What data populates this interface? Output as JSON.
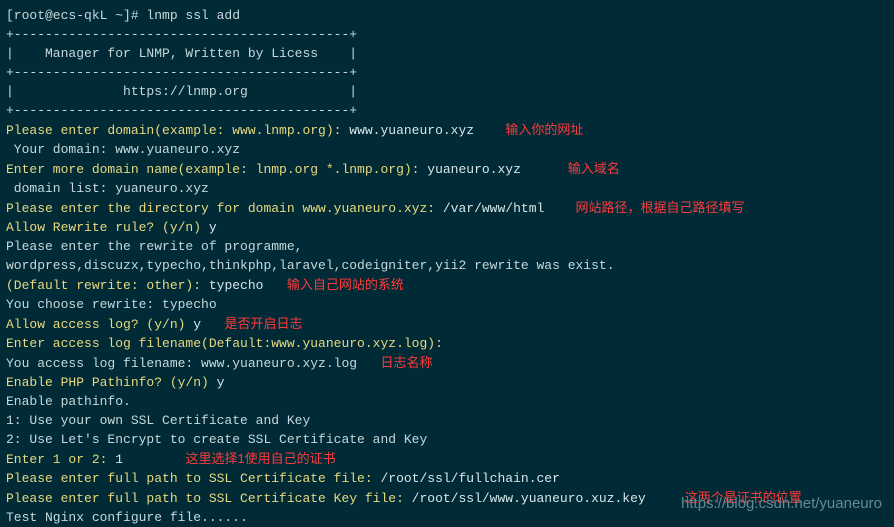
{
  "prompt_line": "[root@ecs-qkL ~]# lnmp ssl add",
  "sep": "+-------------------------------------------+",
  "banner1": "|    Manager for LNMP, Written by Licess    |",
  "banner2": "|              https://lnmp.org             |",
  "s1": {
    "prompt": "Please enter domain(example: www.lnmp.org): ",
    "val": "www.yuaneuro.xyz",
    "note": "输入你的网址"
  },
  "s1b": " Your domain: www.yuaneuro.xyz",
  "s2": {
    "prompt": "Enter more domain name(example: lnmp.org *.lnmp.org): ",
    "val": "yuaneuro.xyz",
    "note": "输入域名"
  },
  "s2b": " domain list: yuaneuro.xyz",
  "s3": {
    "prompt": "Please enter the directory for domain www.yuaneuro.xyz: ",
    "val": "/var/www/html",
    "note": "网站路径，根据自己路径填写"
  },
  "s4": {
    "prompt": "Allow Rewrite rule? (y/n) ",
    "val": "y"
  },
  "s5a": "Please enter the rewrite of programme, ",
  "s5b": "wordpress,discuzx,typecho,thinkphp,laravel,codeigniter,yii2 rewrite was exist.",
  "s6": {
    "prompt": "(Default rewrite: other): ",
    "val": "typecho",
    "note": "输入自己网站的系统"
  },
  "s6b": "You choose rewrite: typecho",
  "s7": {
    "prompt": "Allow access log? (y/n) ",
    "val": "y",
    "note": "是否开启日志"
  },
  "s8": {
    "prompt": "Enter access log filename(Default:www.yuaneuro.xyz.log): "
  },
  "s8b": {
    "t": "You access log filename: www.yuaneuro.xyz.log",
    "note": "日志名称"
  },
  "s9": {
    "prompt": "Enable PHP Pathinfo? (y/n) ",
    "val": "y"
  },
  "s9b": "Enable pathinfo.",
  "s10a": "1: Use your own SSL Certificate and Key",
  "s10b": "2: Use Let's Encrypt to create SSL Certificate and Key",
  "s11": {
    "prompt": "Enter 1 or 2: ",
    "val": "1",
    "note": "这里选择1使用自己的证书"
  },
  "s12": {
    "prompt": "Please enter full path to SSL Certificate file: ",
    "val": "/root/ssl/fullchain.cer"
  },
  "s13": {
    "prompt": "Please enter full path to SSL Certificate Key file: ",
    "val": "/root/ssl/www.yuaneuro.xuz.key",
    "note": "这两个是证书的位置"
  },
  "s14": "Test Nginx configure file......",
  "watermark": "https://blog.csdn.net/yuaneuro"
}
